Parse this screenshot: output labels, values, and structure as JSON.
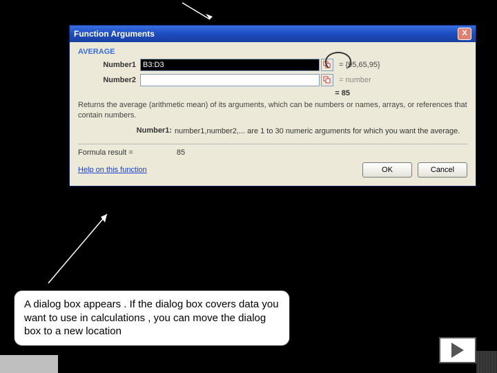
{
  "dialog": {
    "title": "Function Arguments",
    "function_name": "AVERAGE",
    "args": [
      {
        "label": "Number1",
        "value": "B3:D3",
        "result": "= {95,65,95}"
      },
      {
        "label": "Number2",
        "value": "",
        "result": "= number"
      }
    ],
    "calc_result_eq": "= 85",
    "description": "Returns the average (arithmetic mean) of its arguments, which can be numbers or names, arrays, or references that contain numbers.",
    "arg_help_label": "Number1:",
    "arg_help_text": "number1,number2,... are 1 to 30 numeric arguments for which you want the average.",
    "formula_result_label": "Formula result =",
    "formula_result_value": "85",
    "help_link": "Help on this function",
    "ok_label": "OK",
    "cancel_label": "Cancel",
    "close_label": "X"
  },
  "caption": "A dialog box appears . If the dialog box covers data you want to use in calculations , you can move the dialog box  to a new location"
}
